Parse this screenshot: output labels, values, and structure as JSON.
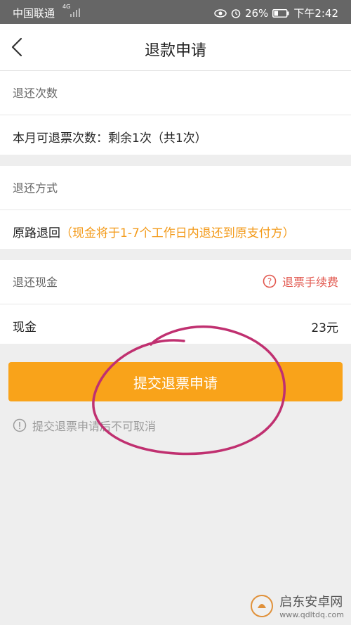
{
  "status_bar": {
    "carrier": "中国联通",
    "network": "4G",
    "battery": "26%",
    "time": "下午2:42"
  },
  "nav": {
    "title": "退款申请"
  },
  "refund_times": {
    "header": "退还次数",
    "text": "本月可退票次数：剩余1次（共1次）"
  },
  "refund_method": {
    "header": "退还方式",
    "method": "原路退回",
    "note": "（现金将于1-7个工作日内退还到原支付方）"
  },
  "refund_cash": {
    "header": "退还现金",
    "fee_link": "退票手续费",
    "label": "现金",
    "value": "23元"
  },
  "submit_button": {
    "label": "提交退票申请"
  },
  "notice": {
    "text": "提交退票申请后不可取消"
  },
  "watermark": {
    "title": "启东安卓网",
    "url": "www.qdltdq.com"
  },
  "colors": {
    "accent": "#f9a31a",
    "accent_text": "#f39a19",
    "fee_red": "#e2584f",
    "annotation": "#c03070"
  },
  "icons": [
    "back-chevron-icon",
    "question-circle-icon",
    "exclamation-circle-icon",
    "eye-icon",
    "alarm-icon",
    "battery-icon",
    "signal-icon"
  ]
}
